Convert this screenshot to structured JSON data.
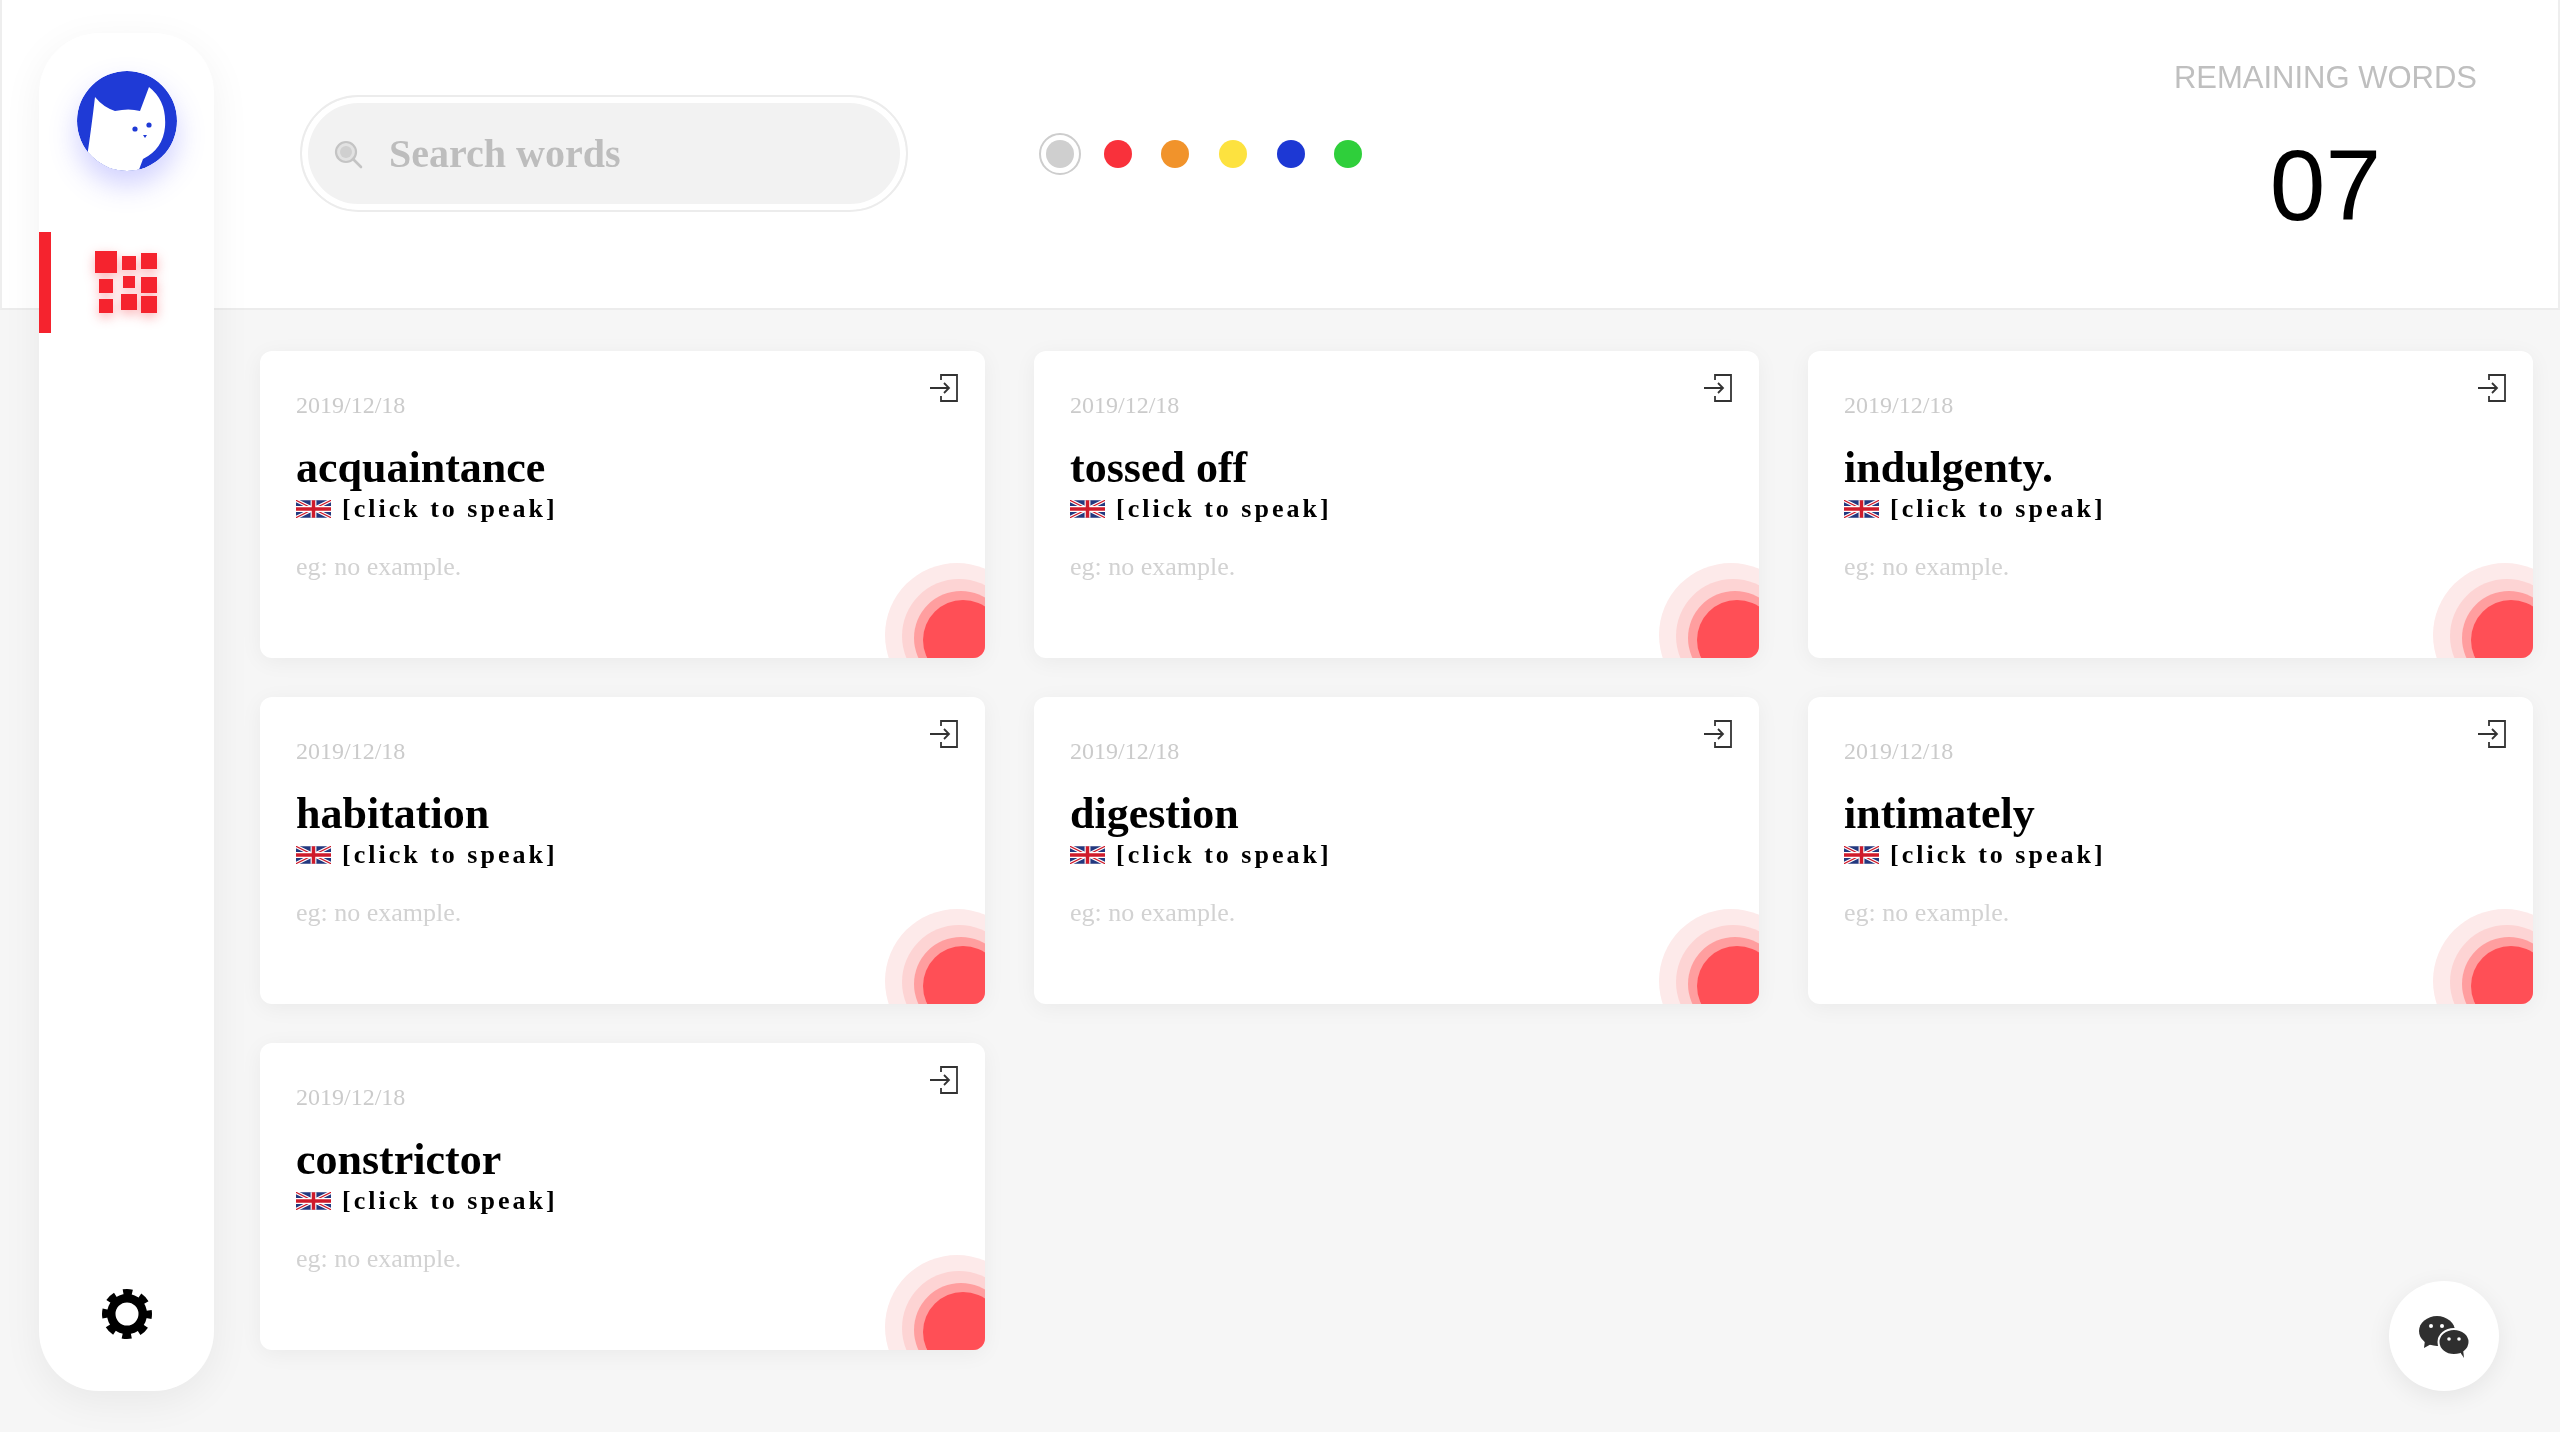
{
  "sidebar": {
    "items": [
      {
        "selected": true
      }
    ]
  },
  "search": {
    "placeholder": "Search words"
  },
  "color_filters": [
    {
      "color": "#cfcfcf",
      "selected": true
    },
    {
      "color": "#f9313b",
      "selected": false
    },
    {
      "color": "#f1932b",
      "selected": false
    },
    {
      "color": "#fde23f",
      "selected": false
    },
    {
      "color": "#1d38d4",
      "selected": false
    },
    {
      "color": "#2fcf3b",
      "selected": false
    }
  ],
  "remaining": {
    "label": "REMAINING WORDS",
    "count": "07"
  },
  "cards": [
    {
      "date": "2019/12/18",
      "word": "acquaintance",
      "speak": "[click to speak]",
      "example": "eg: no example."
    },
    {
      "date": "2019/12/18",
      "word": "tossed off",
      "speak": "[click to speak]",
      "example": "eg: no example."
    },
    {
      "date": "2019/12/18",
      "word": "indulgenty.",
      "speak": "[click to speak]",
      "example": "eg: no example."
    },
    {
      "date": "2019/12/18",
      "word": "habitation",
      "speak": "[click to speak]",
      "example": "eg: no example."
    },
    {
      "date": "2019/12/18",
      "word": "digestion",
      "speak": "[click to speak]",
      "example": "eg: no example."
    },
    {
      "date": "2019/12/18",
      "word": "intimately",
      "speak": "[click to speak]",
      "example": "eg: no example."
    },
    {
      "date": "2019/12/18",
      "word": "constrictor",
      "speak": "[click to speak]",
      "example": "eg: no example."
    }
  ]
}
